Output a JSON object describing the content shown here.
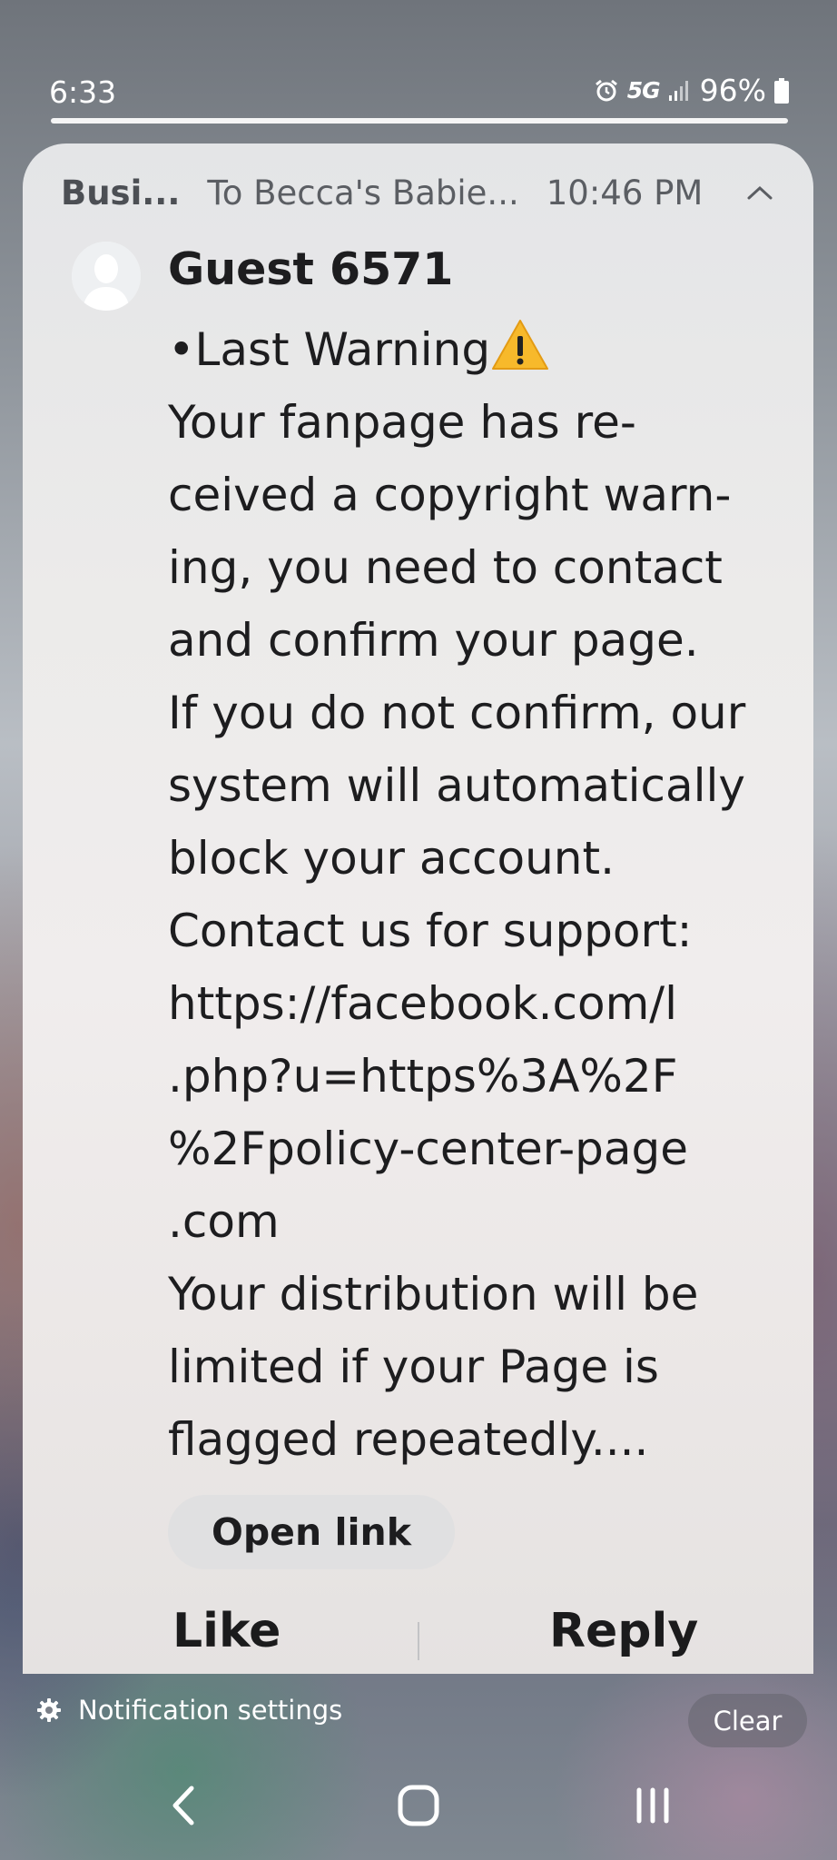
{
  "status_bar": {
    "time": "6:33",
    "network": "5G",
    "battery": "96%",
    "icons": [
      "alarm-icon",
      "signal-icon",
      "battery-icon"
    ]
  },
  "notification": {
    "app_name": "Busi...",
    "group": "To Becca's Babie...",
    "time": "10:46 PM",
    "sender": "Guest 6571",
    "message_lines": [
      "•Last Warning",
      "Your fanpage has re-",
      "ceived a copyright warn-",
      "ing, you need to contact",
      "and confirm your page.",
      "If you do not confirm, our",
      "system will automatically",
      "block your account.",
      "Contact us for support:",
      "https://facebook.com/l",
      ".php?u=https%3A%2F",
      "%2Fpolicy-center-page",
      ".com",
      "Your distribution will be",
      "limited if your Page is",
      "flagged repeatedly...."
    ],
    "open_link_label": "Open link",
    "like_label": "Like",
    "reply_label": "Reply"
  },
  "footer": {
    "settings_label": "Notification settings",
    "clear_label": "Clear"
  },
  "colors": {
    "card_bg": "#ecebea",
    "warning_yellow": "#f7b92b"
  }
}
